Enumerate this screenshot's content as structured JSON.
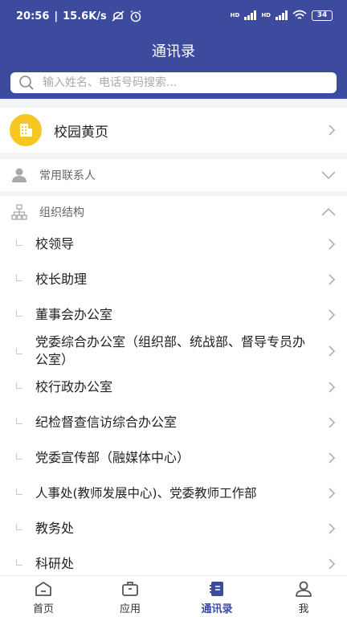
{
  "status_bar": {
    "time": "20:56",
    "speed": "15.6K/s",
    "network_1": "HD",
    "network_2": "HD",
    "battery": "34"
  },
  "header": {
    "title": "通讯录",
    "search_placeholder": "输入姓名、电话号码搜索..."
  },
  "yellow_pages": {
    "label": "校园黄页",
    "icon": "building-icon"
  },
  "sections": {
    "common_contacts": {
      "label": "常用联系人",
      "icon": "person-icon"
    },
    "org_structure": {
      "label": "组织结构",
      "icon": "org-chart-icon"
    }
  },
  "org_items": [
    {
      "label": "校领导"
    },
    {
      "label": "校长助理"
    },
    {
      "label": "董事会办公室"
    },
    {
      "label": "党委综合办公室（组织部、统战部、督导专员办公室）"
    },
    {
      "label": "校行政办公室"
    },
    {
      "label": "纪检督查信访综合办公室"
    },
    {
      "label": "党委宣传部（融媒体中心）"
    },
    {
      "label": "人事处(教师发展中心)、党委教师工作部"
    },
    {
      "label": "教务处"
    },
    {
      "label": "科研处"
    }
  ],
  "tabs": [
    {
      "label": "首页",
      "icon": "home-icon"
    },
    {
      "label": "应用",
      "icon": "briefcase-icon"
    },
    {
      "label": "通讯录",
      "icon": "contacts-book-icon",
      "active": true
    },
    {
      "label": "我",
      "icon": "user-icon"
    }
  ],
  "colors": {
    "primary": "#3c4b9e",
    "yellow_icon": "#f6c623"
  }
}
